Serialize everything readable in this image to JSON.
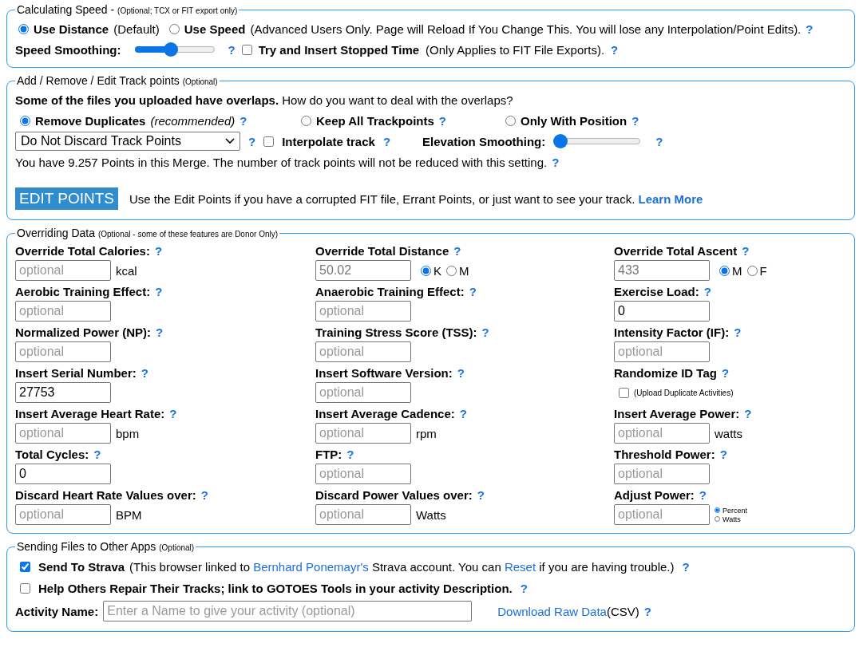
{
  "speed": {
    "legend": "Calculating Speed -",
    "note": "(Optional; TCX or FIT export only)",
    "modes": [
      {
        "label": "Use Distance",
        "note": "(Default)",
        "selected": true
      },
      {
        "label": "Use Speed",
        "note": "(Advanced Users Only. Page will Reload If You Change This. You will lose any Interpolation/Point Edits).",
        "selected": false,
        "help": "?"
      }
    ],
    "smoothing": {
      "label": "Speed Smoothing:",
      "level": 0.45,
      "help": "?"
    },
    "stopped": {
      "label": "Try and Insert Stopped Time",
      "note": "(Only Applies to FIT File Exports).",
      "checked": false,
      "help": "?"
    }
  },
  "track": {
    "legend": "Add / Remove / Edit Track points",
    "note": "(Optional)",
    "intro": "**Some of the files you uploaded have overlaps.** How do you want to deal with the overlaps?",
    "options": [
      {
        "label": "Remove Duplicates",
        "note": "(recommended)",
        "selected": true,
        "help": "?"
      },
      {
        "label": "Keep All Trackpoints",
        "selected": false,
        "help": "?"
      },
      {
        "label": "Only With Position",
        "selected": false,
        "help": "?"
      }
    ],
    "discard_select": {
      "value": "Do Not Discard Track Points",
      "help": "?"
    },
    "interpolate": {
      "label": "Interpolate track",
      "checked": false,
      "help": "?"
    },
    "elevation": {
      "label": "Elevation Smoothing:",
      "level": 0,
      "help": "?"
    },
    "summary": "You have 9.257 Points in this Merge. The number of track points will not be reduced with this setting.",
    "summary_help": "?",
    "edit_button": "EDIT POINTS",
    "edit_text": "Use the Edit Points if you have a corrupted FIT file, Errant Points, or just want to see your track.",
    "learn_more": "Learn More"
  },
  "overrides": {
    "legend": "Overriding Data",
    "note": "(Optional - some of these features are Donor Only)",
    "fields": [
      {
        "kind": "input",
        "label": "Override Total Calories:",
        "help": "?",
        "placeholder": "optional",
        "unit": "kcal"
      },
      {
        "kind": "input",
        "label": "Override Total Distance",
        "help": "?",
        "value": "50.02",
        "dim": true,
        "units": [
          {
            "label": "K",
            "selected": true
          },
          {
            "label": "M",
            "selected": false
          }
        ]
      },
      {
        "kind": "input",
        "label": "Override Total Ascent",
        "help": "?",
        "value": "433",
        "dim": true,
        "units": [
          {
            "label": "M",
            "selected": true
          },
          {
            "label": "F",
            "selected": false
          }
        ]
      },
      {
        "kind": "input",
        "label": "Aerobic Training Effect:",
        "help": "?",
        "placeholder": "optional"
      },
      {
        "kind": "input",
        "label": "Anaerobic Training Effect:",
        "help": "?",
        "placeholder": "optional"
      },
      {
        "kind": "input",
        "label": "Exercise Load:",
        "help": "?",
        "value": "0"
      },
      {
        "kind": "input",
        "label": "Normalized Power (NP):",
        "help": "?",
        "placeholder": "optional"
      },
      {
        "kind": "input",
        "label": "Training Stress Score (TSS):",
        "help": "?",
        "placeholder": "optional"
      },
      {
        "kind": "input",
        "label": "Intensity Factor (IF):",
        "help": "?",
        "placeholder": "optional"
      },
      {
        "kind": "input",
        "label": "Insert Serial Number:",
        "help": "?",
        "value": "27753"
      },
      {
        "kind": "input",
        "label": "Insert Software Version:",
        "help": "?",
        "placeholder": "optional"
      },
      {
        "kind": "checkbox",
        "label": "Randomize ID Tag",
        "help": "?",
        "checked": false,
        "note": "(Upload Duplicate Activities)"
      },
      {
        "kind": "input",
        "label": "Insert Average Heart Rate:",
        "help": "?",
        "placeholder": "optional",
        "unit": "bpm"
      },
      {
        "kind": "input",
        "label": "Insert Average Cadence:",
        "help": "?",
        "placeholder": "optional",
        "unit": "rpm"
      },
      {
        "kind": "input",
        "label": "Insert Average Power:",
        "help": "?",
        "placeholder": "optional",
        "unit": "watts"
      },
      {
        "kind": "input",
        "label": "Total Cycles:",
        "help": "?",
        "value": "0"
      },
      {
        "kind": "input",
        "label": "FTP:",
        "help": "?",
        "placeholder": "optional"
      },
      {
        "kind": "input",
        "label": "Threshold Power:",
        "help": "?",
        "placeholder": "optional"
      },
      {
        "kind": "input",
        "label": "Discard Heart Rate Values over:",
        "help": "?",
        "placeholder": "optional",
        "unit": "BPM"
      },
      {
        "kind": "input",
        "label": "Discard Power Values over:",
        "help": "?",
        "placeholder": "optional",
        "unit": "Watts"
      },
      {
        "kind": "input",
        "label": "Adjust Power:",
        "help": "?",
        "placeholder": "optional",
        "stacked": true,
        "units": [
          {
            "label": "Percent",
            "selected": true
          },
          {
            "label": "Watts",
            "selected": false
          }
        ]
      }
    ]
  },
  "sending": {
    "legend": "Sending Files to Other Apps",
    "note": "(Optional)",
    "strava": {
      "checked": true,
      "label": "Send To Strava",
      "parts": [
        {
          "text": "(This browser linked to "
        },
        {
          "text": "Bernhard Ponemayr's",
          "link": true
        },
        {
          "text": " Strava account. You can "
        },
        {
          "text": "Reset",
          "link": true
        },
        {
          "text": " if you are having trouble.)"
        }
      ],
      "help": "?"
    },
    "repair": {
      "checked": false,
      "label": "Help Others Repair Their Tracks; link to GOTOES Tools in your activity Description.",
      "help": "?"
    },
    "activity": {
      "label": "Activity Name:",
      "placeholder": "Enter a Name to give your activity (optional)"
    },
    "download": {
      "link": "Download Raw Data",
      "note": "(CSV)",
      "help": "?"
    }
  }
}
